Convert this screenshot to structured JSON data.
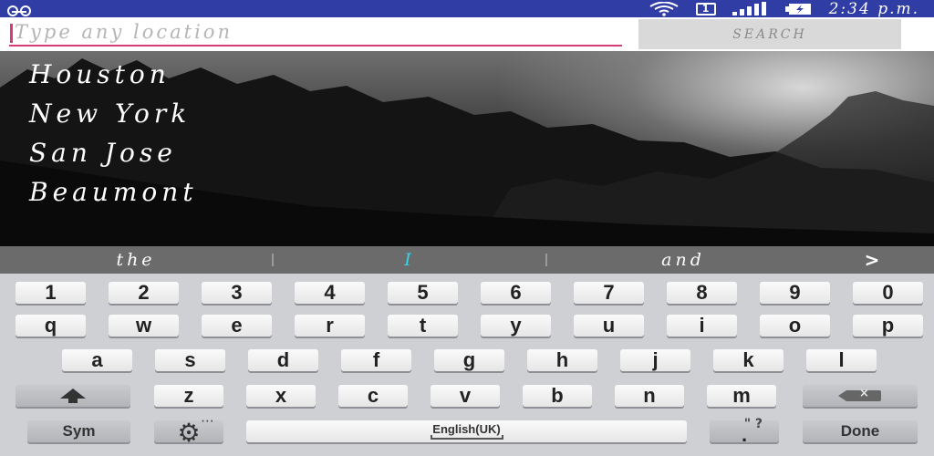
{
  "status_bar": {
    "time": "2:34 p.m.",
    "sim_label": "1",
    "icons": [
      "voicemail-icon",
      "wifi-icon",
      "sim-icon",
      "signal-icon",
      "battery-charging-icon"
    ]
  },
  "search": {
    "placeholder": "Type any location",
    "value": "",
    "button_label": "SEARCH"
  },
  "locations": [
    "Houston",
    "New York",
    "San Jose",
    "Beaumont"
  ],
  "keyboard": {
    "suggestions": [
      "the",
      "I",
      "and"
    ],
    "suggestion_more": ">",
    "highlight_color": "#33d6e6",
    "number_row": [
      "1",
      "2",
      "3",
      "4",
      "5",
      "6",
      "7",
      "8",
      "9",
      "0"
    ],
    "row1": [
      "q",
      "w",
      "e",
      "r",
      "t",
      "y",
      "u",
      "i",
      "o",
      "p"
    ],
    "row2": [
      "a",
      "s",
      "d",
      "f",
      "g",
      "h",
      "j",
      "k",
      "l"
    ],
    "row3": [
      "z",
      "x",
      "c",
      "v",
      "b",
      "n",
      "m"
    ],
    "sym_label": "Sym",
    "space_label": "English(UK)",
    "punct_label": ".",
    "punct_alt": "\" ?",
    "done_label": "Done"
  }
}
